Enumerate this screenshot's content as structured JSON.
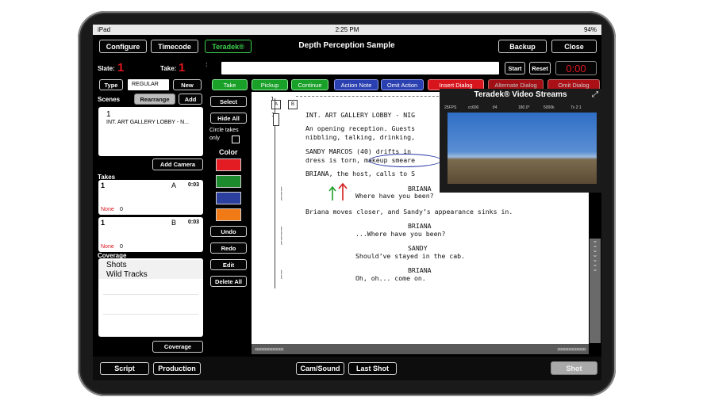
{
  "status": {
    "device": "iPad",
    "time": "2:25 PM",
    "battery": "94%"
  },
  "topbar": {
    "configure": "Configure",
    "timecode": "Timecode",
    "teradek": "Teradek®",
    "title": "Depth Perception Sample",
    "backup": "Backup",
    "close": "Close"
  },
  "slate": {
    "slate_label": "Slate:",
    "slate_value": "1",
    "take_label": "Take:",
    "take_value": "1",
    "start": "Start",
    "reset": "Reset",
    "timer": "0:00"
  },
  "type_row": {
    "type": "Type",
    "value": "REGULAR",
    "new": "New"
  },
  "tags": [
    {
      "label": "Take",
      "color": "grn"
    },
    {
      "label": "Pickup",
      "color": "grn"
    },
    {
      "label": "Continue",
      "color": "grn"
    },
    {
      "label": "Action Note",
      "color": "blu"
    },
    {
      "label": "Omit Action",
      "color": "blu"
    },
    {
      "label": "Insert Dialog",
      "color": "red"
    },
    {
      "label": "Alternate Dialog",
      "color": "red"
    },
    {
      "label": "Omit Dialog",
      "color": "red"
    }
  ],
  "scenes": {
    "label": "Scenes",
    "rearrange": "Rearrange",
    "add": "Add",
    "item_number": "1",
    "item_title": "INT. ART GALLERY LOBBY - N..."
  },
  "add_camera": "Add Camera",
  "takes": {
    "label": "Takes",
    "items": [
      {
        "number": "1",
        "camera": "A",
        "duration": "0:03",
        "status": "None",
        "count": "0"
      },
      {
        "number": "1",
        "camera": "B",
        "duration": "0:03",
        "status": "None",
        "count": "0"
      }
    ]
  },
  "coverage": {
    "label": "Coverage",
    "items": [
      "Shots",
      "Wild Tracks"
    ],
    "button": "Coverage"
  },
  "tools": {
    "select": "Select",
    "hide_all": "Hide All",
    "circle": "Circle takes only",
    "color": "Color",
    "undo": "Undo",
    "redo": "Redo",
    "edit": "Edit",
    "delete_all": "Delete All"
  },
  "swatch_colors": [
    "#e31b23",
    "#1d8a2e",
    "#2b3f9e",
    "#f07b16"
  ],
  "markers": {
    "a": "A",
    "b": "B",
    "one": "1"
  },
  "script_lines": [
    {
      "text": "INT. ART GALLERY LOBBY - NIG",
      "indent": 0
    },
    {
      "text": "An opening reception. Guests",
      "indent": 0
    },
    {
      "text": "nibbling, talking, drinking,",
      "indent": 0
    },
    {
      "text": "SANDY MARCOS (40) drifts in",
      "indent": 0
    },
    {
      "text": "dress is torn, makeup smeare",
      "indent": 0
    },
    {
      "text": "BRIANA, the host, calls to S",
      "indent": 0
    },
    {
      "text": "BRIANA",
      "indent": 2
    },
    {
      "text": "Where have you been?",
      "indent": 1
    },
    {
      "text": "Briana moves closer, and Sandy’s appearance sinks in.",
      "indent": 0
    },
    {
      "text": "BRIANA",
      "indent": 2
    },
    {
      "text": "...Where have you been?",
      "indent": 1
    },
    {
      "text": "SANDY",
      "indent": 2
    },
    {
      "text": "Should’ve stayed in the cab.",
      "indent": 1
    },
    {
      "text": "BRIANA",
      "indent": 2
    },
    {
      "text": "Oh, oh... come on.",
      "indent": 1
    }
  ],
  "video_streams": {
    "title": "Teradek® Video Streams",
    "hud": [
      "25FPS",
      "cc600",
      "f/4",
      "180.0°",
      "5000k",
      "7x 2:1"
    ]
  },
  "bottombar": {
    "script": "Script",
    "production": "Production",
    "cam_sound": "Cam/Sound",
    "last_shot": "Last Shot",
    "shot": "Shot"
  }
}
